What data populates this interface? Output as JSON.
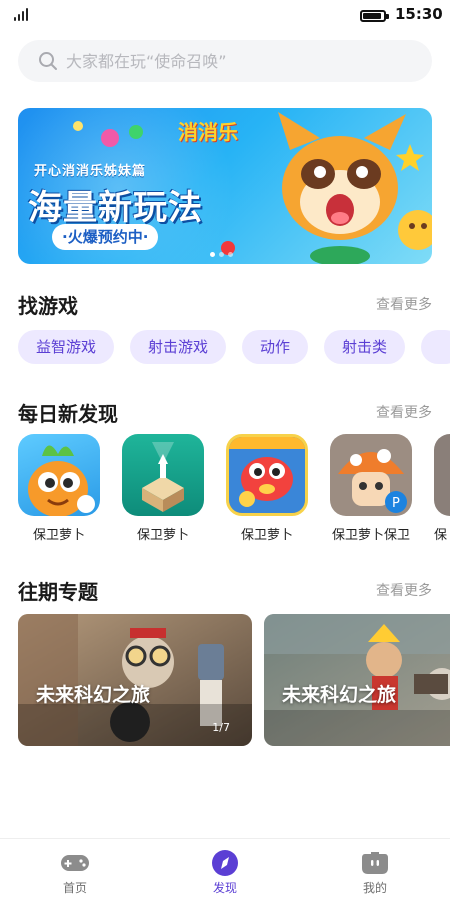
{
  "status_bar": {
    "time": "15:30"
  },
  "search": {
    "placeholder": "大家都在玩“使命召唤”"
  },
  "banner": {
    "logo_text": "消消乐",
    "subtitle": "开心消消乐姊妹篇",
    "title": "海量新玩法",
    "tag": "·火爆预约中·",
    "pages": 3,
    "current_page": 1
  },
  "find_games": {
    "title": "找游戏",
    "more": "查看更多",
    "chips": [
      "益智游戏",
      "射击游戏",
      "动作",
      "射击类"
    ]
  },
  "daily": {
    "title": "每日新发现",
    "more": "查看更多",
    "apps": [
      {
        "name": "保卫萝卜"
      },
      {
        "name": "保卫萝卜"
      },
      {
        "name": "保卫萝卜"
      },
      {
        "name": "保卫萝卜保卫"
      },
      {
        "name": "保"
      }
    ]
  },
  "topics": {
    "title": "往期专题",
    "more": "查看更多",
    "items": [
      {
        "title": "未来科幻之旅",
        "counter": "1/7"
      },
      {
        "title": "未来科幻之旅"
      }
    ]
  },
  "tabbar": {
    "items": [
      {
        "label": "首页",
        "icon": "gamepad-icon"
      },
      {
        "label": "发现",
        "icon": "compass-icon"
      },
      {
        "label": "我的",
        "icon": "profile-icon"
      }
    ],
    "active": 1
  },
  "colors": {
    "accent": "#5b3fd4",
    "chip_bg": "#ede9ff",
    "muted": "#9a9a9a"
  }
}
